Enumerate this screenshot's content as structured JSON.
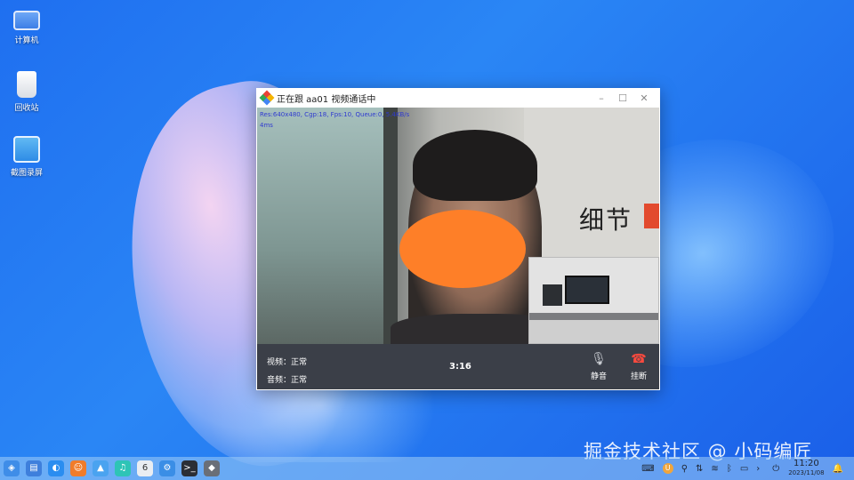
{
  "desktop": {
    "icons": [
      {
        "label": "计算机"
      },
      {
        "label": "回收站"
      },
      {
        "label": "截图录屏"
      }
    ]
  },
  "call_window": {
    "title": "正在跟 aa01 视频通话中",
    "window_buttons": {
      "minimize": "–",
      "maximize": "☐",
      "close": "✕"
    },
    "video_info_line1": "Res:640x480, Cgp:18, Fps:10, Queue:0, 5.4KB/s",
    "video_info_line2": "4ms",
    "status_video": "视频：正常",
    "status_audio": "音频：正常",
    "timer": "3:16",
    "mute_label": "静音",
    "hangup_label": "挂断",
    "mute_icon": "🎙",
    "hangup_icon": "☎"
  },
  "watermark": "掘金技术社区 @ 小码编匠",
  "taskbar": {
    "apps": [
      {
        "name": "start-menu",
        "glyph": "◈",
        "color": "#3f8de8"
      },
      {
        "name": "file-manager",
        "glyph": "▤",
        "color": "#3e7fdc"
      },
      {
        "name": "browser",
        "glyph": "◐",
        "color": "#2a8df0"
      },
      {
        "name": "app-store",
        "glyph": "☺",
        "color": "#f07c2a"
      },
      {
        "name": "image-viewer",
        "glyph": "▲",
        "color": "#4aa3f0"
      },
      {
        "name": "music",
        "glyph": "♫",
        "color": "#2ec4b6"
      },
      {
        "name": "calendar",
        "glyph": "6",
        "color": "#e9edf2"
      },
      {
        "name": "settings",
        "glyph": "⚙",
        "color": "#3a8ee6"
      },
      {
        "name": "terminal",
        "glyph": ">_",
        "color": "#2b2f36"
      },
      {
        "name": "video-call-app",
        "glyph": "◆",
        "color": "#6a6f78"
      }
    ],
    "tray": {
      "keyboard": "⌨",
      "ime": "U",
      "usb": "⚲",
      "network_transfer": "⇅",
      "wifi": "≋",
      "bluetooth": "ᛒ",
      "battery": "▭",
      "expand": "›",
      "power": "⏻",
      "notifications": "🔔"
    },
    "time": "11:20",
    "date": "2023/11/08"
  },
  "colors": {
    "accent": "#2a86f5",
    "mask": "#fe7f28",
    "hangup": "#ff4a3e",
    "controls_bg": "#3b3f48"
  }
}
